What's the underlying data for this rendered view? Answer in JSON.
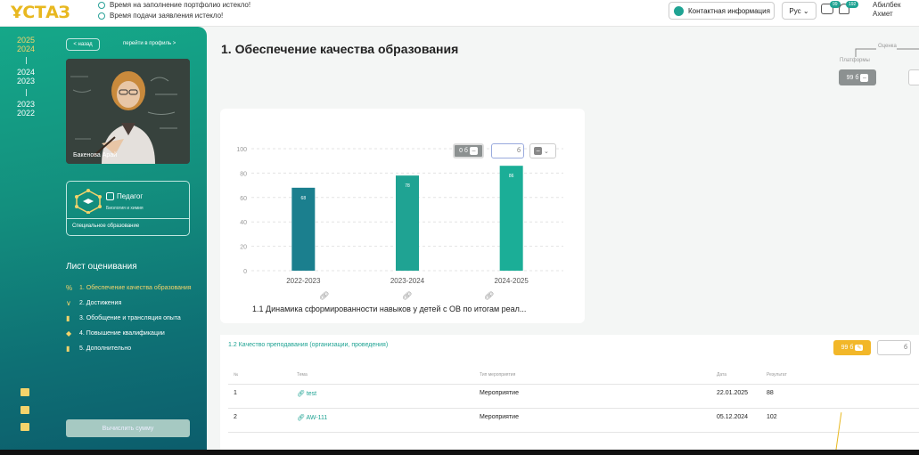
{
  "header": {
    "logo": "ҰСТАЗ",
    "notices": [
      "Время на заполнение портфолио истекло!",
      "Время подачи заявления истекло!"
    ],
    "contact_label": "Контактная информация",
    "lang_label": "Рус",
    "chat_badge": "99",
    "bell_badge": "192",
    "user_line1": "Абилбек",
    "user_line2": "Ахмет"
  },
  "sidebar": {
    "years": [
      "2025",
      "2024",
      "2024",
      "2023",
      "2023",
      "2022"
    ],
    "back_label": "< назад",
    "profile_link": "перейти в профиль  >",
    "person_name": "Бакенова Арай",
    "card_title": "Педагог",
    "card_sub": "Биология и химия",
    "card_footer": "Специальное образование",
    "sheet_title": "Лист оценивания",
    "menu": [
      {
        "label": "1. Обеспечение качества образования",
        "active": true,
        "icon": "percent-icon"
      },
      {
        "label": "2. Достижения",
        "active": false,
        "icon": "medal-icon"
      },
      {
        "label": "3. Обобщение и трансляция опыта",
        "active": false,
        "icon": "document-icon"
      },
      {
        "label": "4. Повышение квалификации",
        "active": false,
        "icon": "graduation-cap-icon"
      },
      {
        "label": "5. Дополнительно",
        "active": false,
        "icon": "book-icon"
      }
    ],
    "calc_button": "Вычислить сумму"
  },
  "main": {
    "title": "1. Обеспечение качества образования",
    "platforms_label": "Платформы",
    "score_label": "Оценка",
    "platforms_value": "99 б",
    "chart_controls": {
      "score": "0 б",
      "input_suffix": "б"
    },
    "chart_caption": "1.1 Динамика сформированности навыков у детей с ОВ по итогам реал...",
    "section_title": "1.2 Качество преподавания (организации, проведения)",
    "section_score": "99 б",
    "section_input_suffix": "б",
    "table": {
      "headers": [
        "№",
        "Тема",
        "Тип мероприятия",
        "Дата",
        "Результат"
      ],
      "rows": [
        [
          "1",
          "test",
          "Мероприятие",
          "22.01.2025",
          "88"
        ],
        [
          "2",
          "AW-111",
          "Мероприятие",
          "05.12.2024",
          "102"
        ]
      ]
    }
  },
  "chart_data": {
    "type": "bar",
    "categories": [
      "2022-2023",
      "2023-2024",
      "2024-2025"
    ],
    "values": [
      68,
      78,
      86
    ],
    "ylim": [
      0,
      100
    ],
    "yticks": [
      0,
      20,
      40,
      60,
      80,
      100
    ],
    "colors": [
      "#1b7f8e",
      "#1fa393",
      "#1bae97"
    ],
    "grid": true
  }
}
